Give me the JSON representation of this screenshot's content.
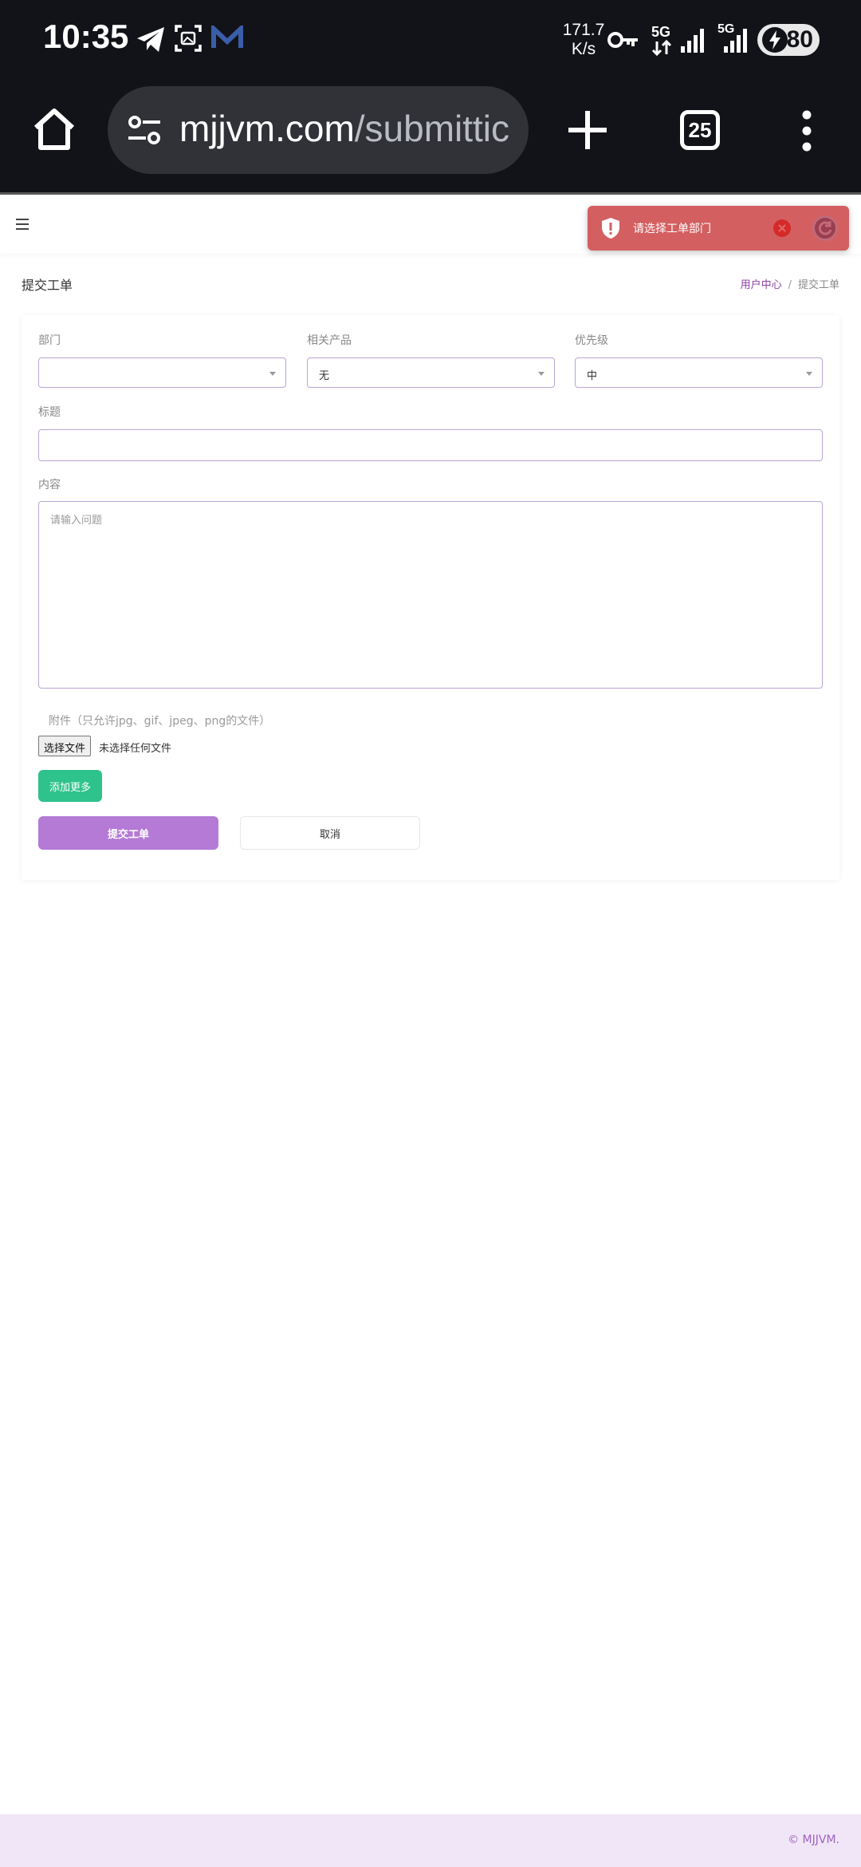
{
  "status_bar": {
    "time": "10:35",
    "net_speed_value": "171.7",
    "net_speed_unit": "K/s",
    "network_1": "5G",
    "network_2": "5G",
    "battery": "80"
  },
  "browser": {
    "url_domain": "mjjvm.com",
    "url_path": "/submittic",
    "tab_count": "25"
  },
  "page": {
    "title": "提交工单",
    "breadcrumb": {
      "home": "用户中心",
      "separator": "/",
      "current": "提交工单"
    }
  },
  "toast": {
    "message": "请选择工单部门",
    "background": "#d45f61"
  },
  "form": {
    "department": {
      "label": "部门",
      "value": ""
    },
    "product": {
      "label": "相关产品",
      "value": "无"
    },
    "priority": {
      "label": "优先级",
      "value": "中"
    },
    "subject": {
      "label": "标题",
      "value": ""
    },
    "content": {
      "label": "内容",
      "placeholder": "请输入问题"
    },
    "attachment": {
      "label": "附件（只允许jpg、gif、jpeg、png的文件）",
      "button": "选择文件",
      "status": "未选择任何文件"
    },
    "add_more": "添加更多",
    "submit": "提交工单",
    "cancel": "取消"
  },
  "footer": {
    "copyright": "© MJJVM."
  },
  "colors": {
    "accent": "#b47ad6",
    "success": "#2ec28c",
    "toast": "#d45f61",
    "footer_bg": "#f0e6f7",
    "link": "#8c3fa0"
  }
}
